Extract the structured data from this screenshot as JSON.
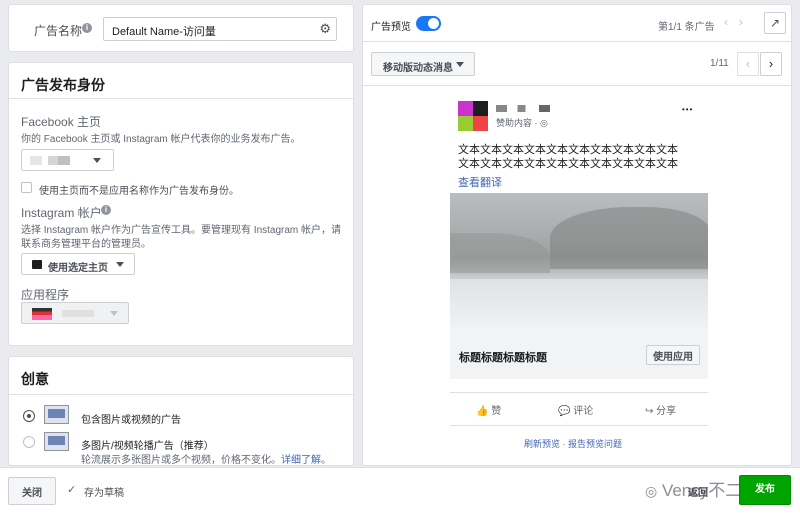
{
  "ad_name": {
    "label": "广告名称",
    "value": "Default Name-访问量"
  },
  "identity": {
    "title": "广告发布身份",
    "facebook_page_label": "Facebook 主页",
    "facebook_page_desc": "你的 Facebook 主页或 Instagram 帐户代表你的业务发布广告。",
    "use_page_name_text": "使用主页而不是应用名称作为广告发布身份。",
    "instagram_label": "Instagram 帐户",
    "instagram_desc_line1": "选择 Instagram 帐户作为广告宣传工具。要管理现有 Instagram 帐户，请",
    "instagram_desc_line2": "联系商务管理平台的管理员。",
    "instagram_select": "使用选定主页",
    "app_label": "应用程序"
  },
  "creative": {
    "title": "创意",
    "option1": "包含图片或视频的广告",
    "option2": "多图片/视频轮播广告（推荐）",
    "option2_desc": "轮流展示多张图片或多个视频，价格不变化。",
    "learn_more": "详细了解。"
  },
  "preview": {
    "toggle_label": "广告预览",
    "ad_count": "第1/1 条广告",
    "placement_select": "移动版动态消息",
    "page_count": "1/11",
    "sponsored": "赞助内容 · ",
    "body_text_line1": "文本文本文本文本文本文本文本文本文本文本",
    "body_text_line2": "文本文本文本文本文本文本文本文本文本文本",
    "see_translation": "查看翻译",
    "headline": "标题标题标题标题",
    "cta": "使用应用",
    "like": "赞",
    "comment": "评论",
    "share": "分享",
    "refresh": "刷新预览",
    "sep": " · ",
    "report": "报告预览问题",
    "more_dots": "•••"
  },
  "footer": {
    "close": "关闭",
    "saved": "存为草稿",
    "back": "返回",
    "publish": "发布",
    "watermark": "Vency不二"
  },
  "colors": {
    "toggle": "#1877f2",
    "publish": "#00a400",
    "link": "#4267b2"
  }
}
